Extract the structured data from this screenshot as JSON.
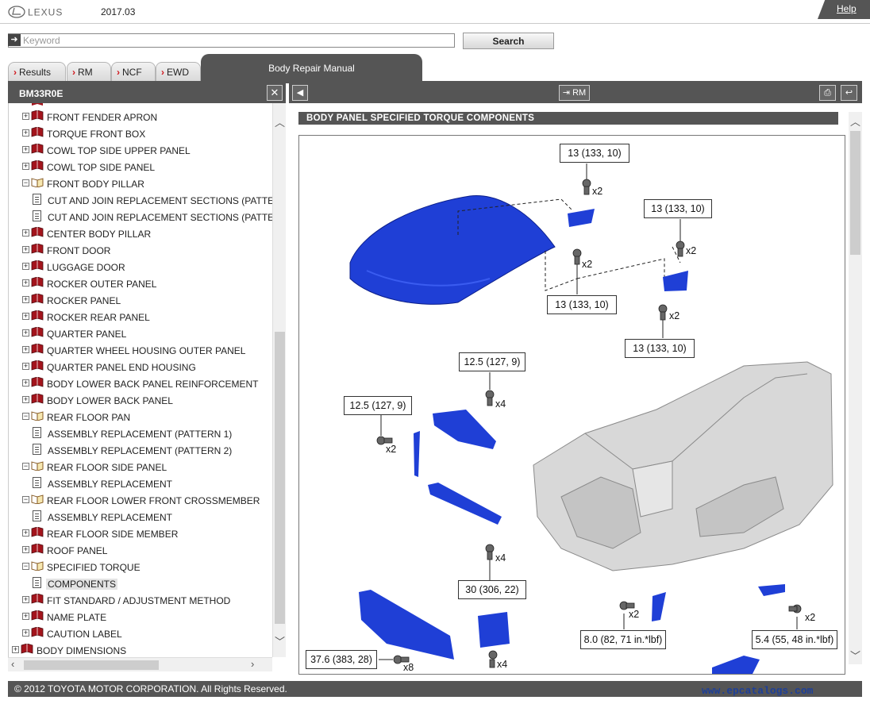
{
  "header": {
    "brand": "LEXUS",
    "version": "2017.03",
    "help_label": "Help"
  },
  "search": {
    "placeholder": "Keyword",
    "button_label": "Search"
  },
  "tabs": [
    {
      "label": "Results"
    },
    {
      "label": "RM"
    },
    {
      "label": "NCF"
    },
    {
      "label": "EWD"
    }
  ],
  "active_tab": "Body Repair Manual",
  "left_panel": {
    "title": "BM33R0E",
    "tree": [
      {
        "label": "FRONT FENDER APRON",
        "type": "book",
        "level": 1,
        "expanded": false
      },
      {
        "label": "TORQUE FRONT BOX",
        "type": "book",
        "level": 1,
        "expanded": false
      },
      {
        "label": "COWL TOP SIDE UPPER PANEL",
        "type": "book",
        "level": 1,
        "expanded": false
      },
      {
        "label": "COWL TOP SIDE PANEL",
        "type": "book",
        "level": 1,
        "expanded": false
      },
      {
        "label": "FRONT BODY PILLAR",
        "type": "open-book",
        "level": 1,
        "expanded": true
      },
      {
        "label": "CUT AND JOIN REPLACEMENT SECTIONS (PATTERN",
        "type": "page",
        "level": 2
      },
      {
        "label": "CUT AND JOIN REPLACEMENT SECTIONS (PATTERN",
        "type": "page",
        "level": 2
      },
      {
        "label": "CENTER BODY PILLAR",
        "type": "book",
        "level": 1,
        "expanded": false
      },
      {
        "label": "FRONT DOOR",
        "type": "book",
        "level": 1,
        "expanded": false
      },
      {
        "label": "LUGGAGE DOOR",
        "type": "book",
        "level": 1,
        "expanded": false
      },
      {
        "label": "ROCKER OUTER PANEL",
        "type": "book",
        "level": 1,
        "expanded": false
      },
      {
        "label": "ROCKER PANEL",
        "type": "book",
        "level": 1,
        "expanded": false
      },
      {
        "label": "ROCKER REAR PANEL",
        "type": "book",
        "level": 1,
        "expanded": false
      },
      {
        "label": "QUARTER PANEL",
        "type": "book",
        "level": 1,
        "expanded": false
      },
      {
        "label": "QUARTER WHEEL HOUSING OUTER PANEL",
        "type": "book",
        "level": 1,
        "expanded": false
      },
      {
        "label": "QUARTER PANEL END HOUSING",
        "type": "book",
        "level": 1,
        "expanded": false
      },
      {
        "label": "BODY LOWER BACK PANEL REINFORCEMENT",
        "type": "book",
        "level": 1,
        "expanded": false
      },
      {
        "label": "BODY LOWER BACK PANEL",
        "type": "book",
        "level": 1,
        "expanded": false
      },
      {
        "label": "REAR FLOOR PAN",
        "type": "open-book",
        "level": 1,
        "expanded": true
      },
      {
        "label": "ASSEMBLY REPLACEMENT (PATTERN 1)",
        "type": "page",
        "level": 2
      },
      {
        "label": "ASSEMBLY REPLACEMENT (PATTERN 2)",
        "type": "page",
        "level": 2
      },
      {
        "label": "REAR FLOOR SIDE PANEL",
        "type": "open-book",
        "level": 1,
        "expanded": true
      },
      {
        "label": "ASSEMBLY REPLACEMENT",
        "type": "page",
        "level": 2
      },
      {
        "label": "REAR FLOOR LOWER FRONT CROSSMEMBER",
        "type": "open-book",
        "level": 1,
        "expanded": true
      },
      {
        "label": "ASSEMBLY REPLACEMENT",
        "type": "page",
        "level": 2
      },
      {
        "label": "REAR FLOOR SIDE MEMBER",
        "type": "book",
        "level": 1,
        "expanded": false
      },
      {
        "label": "ROOF PANEL",
        "type": "book",
        "level": 1,
        "expanded": false
      },
      {
        "label": "SPECIFIED TORQUE",
        "type": "open-book",
        "level": 1,
        "expanded": true
      },
      {
        "label": "COMPONENTS",
        "type": "page",
        "level": 2,
        "selected": true
      },
      {
        "label": "FIT STANDARD / ADJUSTMENT METHOD",
        "type": "book",
        "level": 1,
        "expanded": false
      },
      {
        "label": "NAME PLATE",
        "type": "book",
        "level": 1,
        "expanded": false
      },
      {
        "label": "CAUTION LABEL",
        "type": "book",
        "level": 1,
        "expanded": false
      },
      {
        "label": "BODY DIMENSIONS",
        "type": "book",
        "level": 0,
        "expanded": false
      }
    ]
  },
  "right_panel": {
    "rm_button_label": "RM",
    "section_title": "BODY PANEL  SPECIFIED TORQUE  COMPONENTS",
    "callouts": {
      "c1": "13 (133, 10)",
      "c2": "13 (133, 10)",
      "c3": "13 (133, 10)",
      "c4": "13 (133, 10)",
      "c5": "12.5 (127, 9)",
      "c6": "12.5 (127, 9)",
      "c7": "30 (306, 22)",
      "c8": "8.0 (82, 71 in.*lbf)",
      "c9": "5.4 (55, 48 in.*lbf)",
      "c10": "37.6 (383, 28)"
    },
    "quantities": {
      "q1": "x2",
      "q2": "x2",
      "q3": "x2",
      "q4": "x2",
      "q5": "x4",
      "q6": "x2",
      "q7": "x4",
      "q8": "x2",
      "q9": "x2",
      "q10": "x8",
      "q11": "x4"
    }
  },
  "footer": {
    "copyright": "© 2012 TOYOTA MOTOR CORPORATION. All Rights Reserved.",
    "watermark": "www.epcatalogs.com"
  },
  "colors": {
    "chrome": "#555555",
    "part_blue": "#1f3fd6",
    "tab_arrow": "#d0161c"
  }
}
